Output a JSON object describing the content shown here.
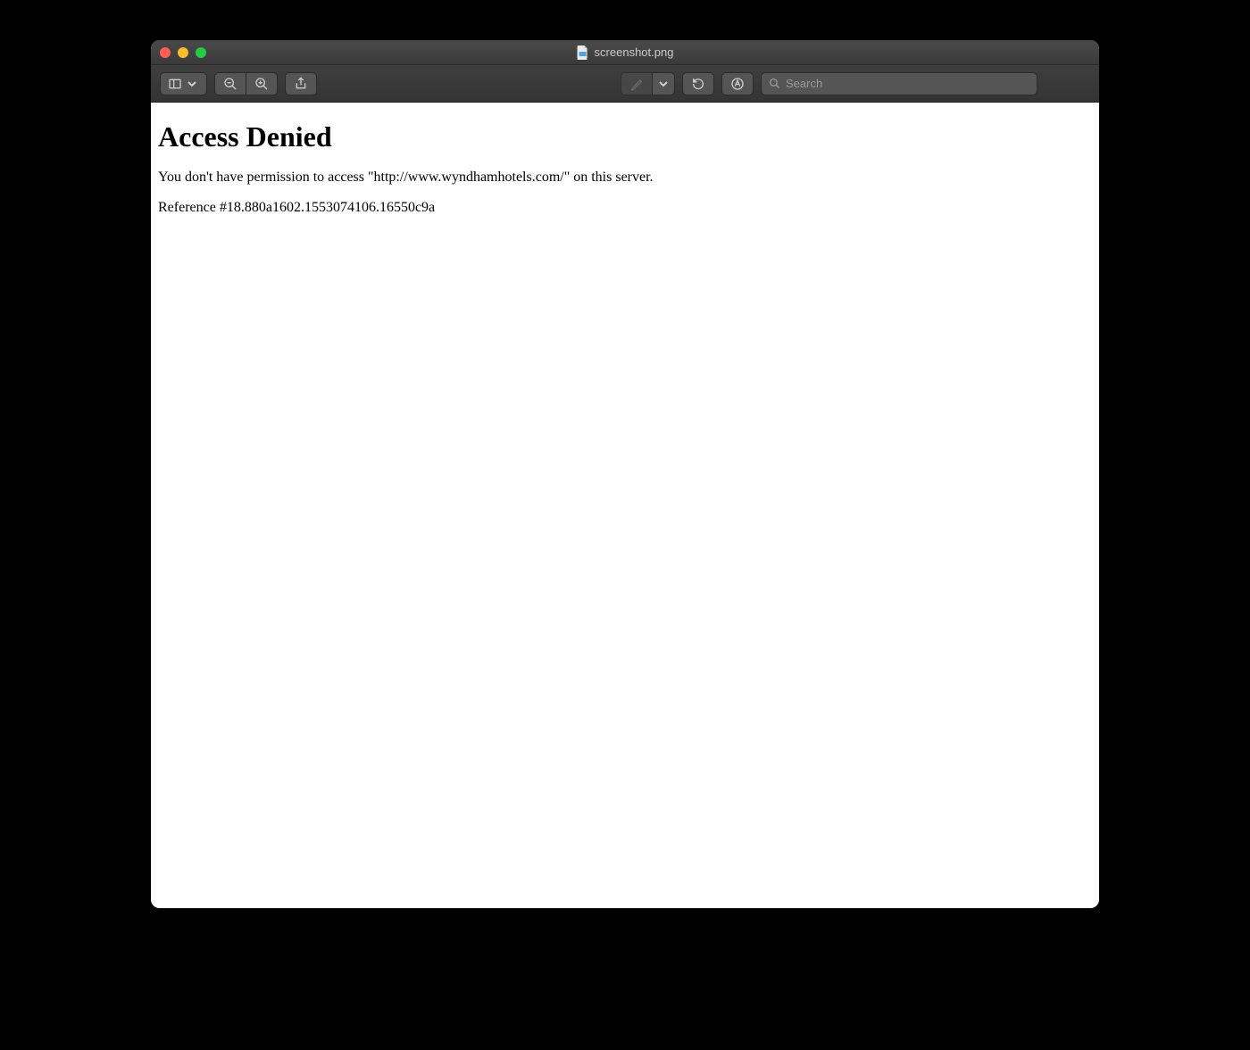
{
  "window": {
    "title": "screenshot.png"
  },
  "toolbar": {
    "search_placeholder": "Search"
  },
  "page": {
    "heading": "Access Denied",
    "message": "You don't have permission to access \"http://www.wyndhamhotels.com/\" on this server.",
    "reference": "Reference #18.880a1602.1553074106.16550c9a"
  }
}
